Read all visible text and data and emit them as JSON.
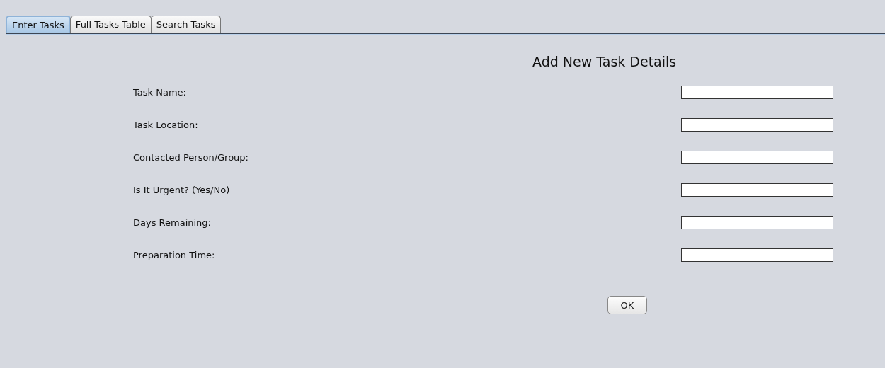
{
  "tabs": [
    {
      "label": "Enter Tasks",
      "selected": true
    },
    {
      "label": "Full Tasks Table",
      "selected": false
    },
    {
      "label": "Search Tasks",
      "selected": false
    }
  ],
  "form": {
    "title": "Add New Task Details",
    "fields": [
      {
        "label": "Task Name:"
      },
      {
        "label": "Task Location:"
      },
      {
        "label": "Contacted Person/Group:"
      },
      {
        "label": "Is It Urgent? (Yes/No)"
      },
      {
        "label": "Days Remaining:"
      },
      {
        "label": "Preparation Time:"
      }
    ],
    "button": "OK"
  }
}
